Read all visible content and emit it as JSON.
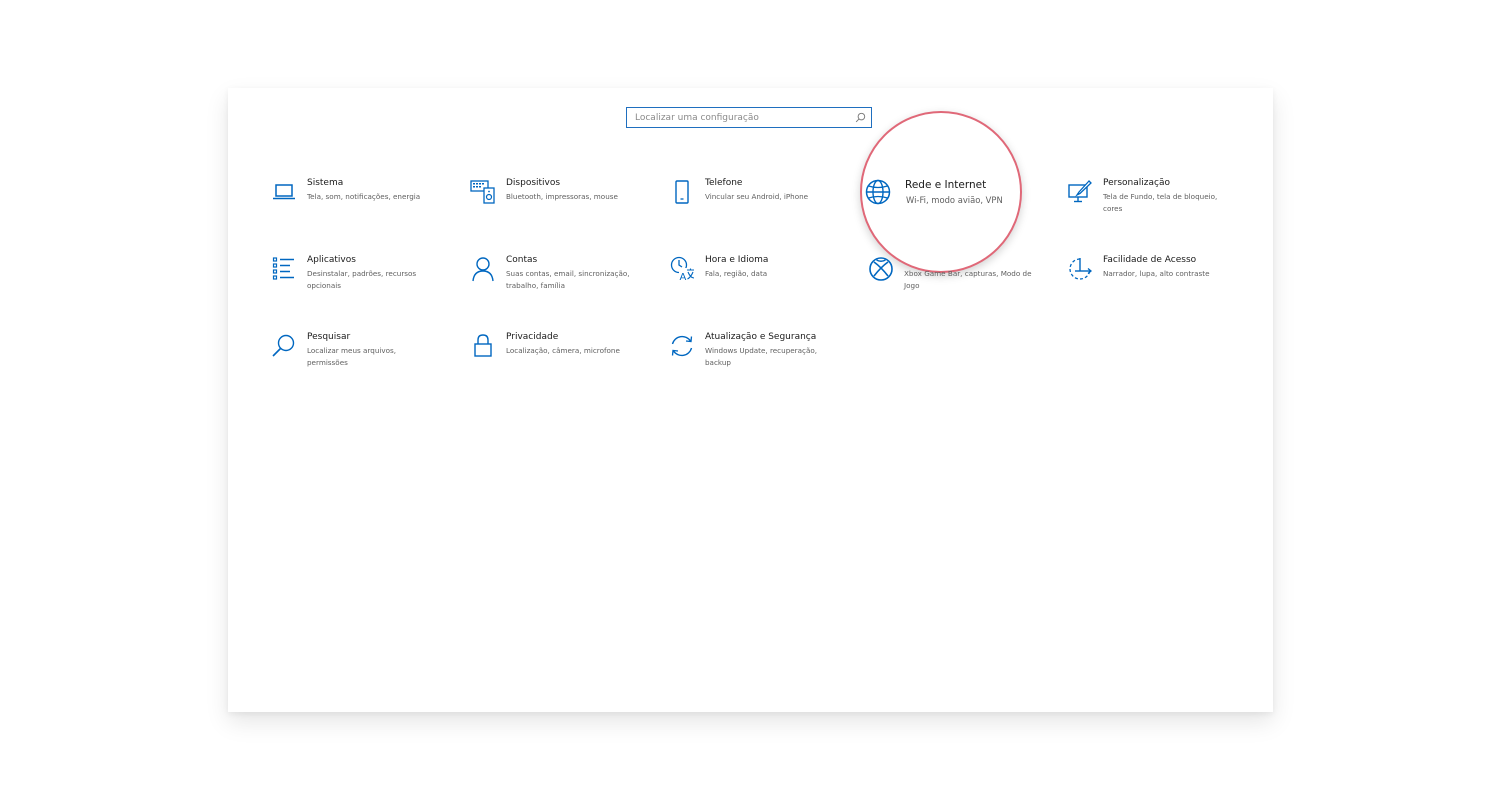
{
  "search": {
    "placeholder": "Localizar uma configuração",
    "icon": "search-icon"
  },
  "categories": [
    {
      "id": "sistema",
      "title": "Sistema",
      "desc": "Tela, som, notificações, energia",
      "icon": "laptop-icon"
    },
    {
      "id": "dispositivos",
      "title": "Dispositivos",
      "desc": "Bluetooth, impressoras, mouse",
      "icon": "keyboard-speaker-icon"
    },
    {
      "id": "telefone",
      "title": "Telefone",
      "desc": "Vincular seu Android, iPhone",
      "icon": "phone-icon"
    },
    {
      "id": "rede",
      "title": "Rede e Internet",
      "desc": "Wi-Fi, modo avião, VPN",
      "icon": "globe-icon"
    },
    {
      "id": "personalizacao",
      "title": "Personalização",
      "desc": "Tela de Fundo, tela de bloqueio, cores",
      "icon": "paint-monitor-icon"
    },
    {
      "id": "aplicativos",
      "title": "Aplicativos",
      "desc": "Desinstalar, padrões, recursos opcionais",
      "icon": "apps-list-icon"
    },
    {
      "id": "contas",
      "title": "Contas",
      "desc": "Suas contas, email, sincronização, trabalho, família",
      "icon": "person-icon"
    },
    {
      "id": "hora",
      "title": "Hora e Idioma",
      "desc": "Fala, região, data",
      "icon": "time-language-icon"
    },
    {
      "id": "jogos",
      "title": "",
      "desc": "Xbox Game Bar, capturas, Modo de Jogo",
      "icon": "xbox-icon"
    },
    {
      "id": "facilidade",
      "title": "Facilidade de Acesso",
      "desc": "Narrador, lupa, alto contraste",
      "icon": "ease-of-access-icon"
    },
    {
      "id": "pesquisar",
      "title": "Pesquisar",
      "desc": "Localizar meus arquivos, permissões",
      "icon": "search-magnifier-icon"
    },
    {
      "id": "privacidade",
      "title": "Privacidade",
      "desc": "Localização, câmera, microfone",
      "icon": "lock-icon"
    },
    {
      "id": "atualizacao",
      "title": "Atualização e Segurança",
      "desc": "Windows Update, recuperação, backup",
      "icon": "sync-arrows-icon"
    }
  ],
  "colors": {
    "accent": "#0067c0",
    "highlight_ring": "#e06878",
    "search_border": "#1f6fbf"
  }
}
